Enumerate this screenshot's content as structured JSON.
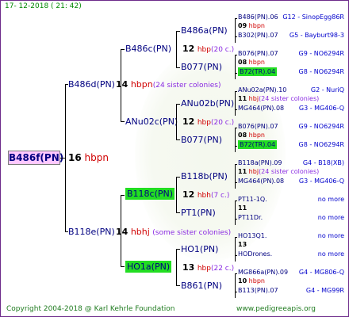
{
  "header": {
    "date": "17- 12-2018 ( 21: 42)"
  },
  "footer": {
    "copyright": "Copyright 2004-2018 @ Karl Kehrle Foundation",
    "site": "www.pedigreeapis.org"
  },
  "colors": {
    "highlight": "#22dd22",
    "root_bg": "#ffc8ff",
    "hbpn": "#d00000",
    "note": "#8a2be2",
    "name": "#000080"
  },
  "root": {
    "name": "B486f(PN)",
    "num": "16",
    "unit": "hbpn"
  },
  "gen1": [
    {
      "name": "B486d(PN)",
      "num": "14",
      "unit": "hbpn",
      "note": "(24 sister colonies)"
    },
    {
      "name": "B118e(PN)",
      "num": "14",
      "unit": "hbhj",
      "note": "(some sister colonies)"
    }
  ],
  "gen2": [
    {
      "name": "B486c(PN)",
      "num": "",
      "unit": "",
      "note": ""
    },
    {
      "name": "ANu02c(PN)",
      "num": "12",
      "unit": "hbp",
      "note": "(20 c.)"
    },
    {
      "name": "B118c(PN)",
      "num": "12",
      "unit": "hbh",
      "note": "(7 c.)"
    },
    {
      "name": "HO1a(PN)",
      "num": "13",
      "unit": "hbp",
      "note": "(22 c.)"
    }
  ],
  "gen3": [
    {
      "name": "B486a(PN)",
      "num": "",
      "unit": "",
      "note": ""
    },
    {
      "name": "B077(PN)",
      "num": "",
      "unit": "",
      "note": ""
    },
    {
      "name": "ANu02b(PN)",
      "num": "",
      "unit": "",
      "note": ""
    },
    {
      "name": "B077(PN)",
      "num": "",
      "unit": "",
      "note": ""
    },
    {
      "name": "B118b(PN)",
      "num": "",
      "unit": "",
      "note": ""
    },
    {
      "name": "PT1(PN)",
      "num": "11",
      "unit": "",
      "note": ""
    },
    {
      "name": "HO1(PN)",
      "num": "13",
      "unit": "",
      "note": ""
    },
    {
      "name": "B861(PN)",
      "num": "",
      "unit": "",
      "note": ""
    }
  ],
  "gen2_inline": {
    "b486c": {
      "num": "12",
      "unit": "hbp",
      "note": "(20 c.)"
    }
  },
  "gen3_inline": [
    {
      "num": "12",
      "unit": "hbp",
      "note": "(20 c.)"
    },
    {
      "num": "",
      "unit": "",
      "note": ""
    },
    {
      "num": "12",
      "unit": "hbp",
      "note": "(20 c.)"
    },
    {
      "num": "",
      "unit": "",
      "note": ""
    },
    {
      "num": "",
      "unit": "",
      "note": ""
    },
    {
      "num": "",
      "unit": "",
      "note": ""
    },
    {
      "num": "",
      "unit": "",
      "note": ""
    },
    {
      "num": "",
      "unit": "",
      "note": ""
    }
  ],
  "gen4": [
    {
      "name": "B486(PN).06",
      "num": "09",
      "unit": "hbpn",
      "right": "G12 - SinopEgg86R"
    },
    {
      "name": "B302(PN).07",
      "right": "G5 - Bayburt98-3"
    },
    {
      "name": "B076(PN).07",
      "num": "08",
      "unit": "hbpn",
      "right": "G9 - NO6294R"
    },
    {
      "name": "B72(TR).04",
      "highlight": true,
      "right": "G8 - NO6294R"
    },
    {
      "name": "ANu02a(PN).10",
      "num": "11",
      "unit": "hbj",
      "note": "(24 sister colonies)",
      "right": "G2 - NuriQ"
    },
    {
      "name": "MG464(PN).08",
      "right": "G3 - MG406-Q"
    },
    {
      "name": "B076(PN).07",
      "num": "08",
      "unit": "hbpn",
      "right": "G9 - NO6294R"
    },
    {
      "name": "B72(TR).04",
      "highlight": true,
      "right": "G8 - NO6294R"
    },
    {
      "name": "B118a(PN).09",
      "num": "11",
      "unit": "hbj",
      "note": "(24 sister colonies)",
      "right": "G4 - B18(XB)"
    },
    {
      "name": "MG464(PN).08",
      "right": "G3 - MG406-Q"
    },
    {
      "name": "PT11-1Q.",
      "num": "11",
      "right": "no more"
    },
    {
      "name": "PT11Dr.",
      "right": "no more"
    },
    {
      "name": "HO13Q1.",
      "num": "13",
      "right": "no more"
    },
    {
      "name": "HODrones.",
      "right": "no more"
    },
    {
      "name": "MG866a(PN).09",
      "num": "10",
      "unit": "hbpn",
      "right": "G4 - MG806-Q"
    },
    {
      "name": "B113(PN).07",
      "right": "G4 - MG99R"
    }
  ]
}
